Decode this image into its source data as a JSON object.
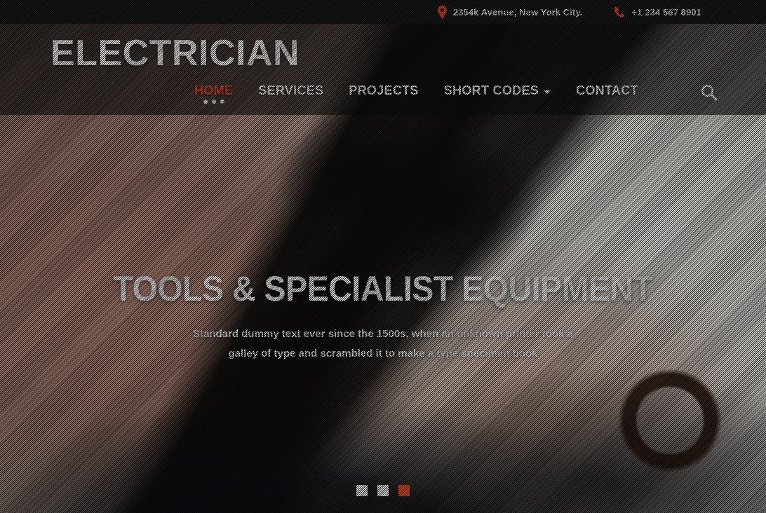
{
  "topbar": {
    "location_icon": "map-pin-icon",
    "address": "2354k Avenue, New York City.",
    "phone_icon": "phone-icon",
    "phone": "+1 234 567 8901"
  },
  "header": {
    "brand": "ELECTRICIAN",
    "search_icon": "search-icon",
    "nav": [
      {
        "label": "HOME",
        "active": true,
        "has_dropdown": false
      },
      {
        "label": "SERVICES",
        "active": false,
        "has_dropdown": false
      },
      {
        "label": "PROJECTS",
        "active": false,
        "has_dropdown": false
      },
      {
        "label": "SHORT CODES",
        "active": false,
        "has_dropdown": true
      },
      {
        "label": "CONTACT",
        "active": false,
        "has_dropdown": false
      }
    ]
  },
  "hero": {
    "title": "TOOLS & SPECIALIST EQUIPMENT",
    "subtitle": "Standard dummy text ever since the 1500s, when an unknown printer took a galley of type and scrambled it to make a type specimen book",
    "slides": [
      {
        "index": 1,
        "active": false
      },
      {
        "index": 2,
        "active": false
      },
      {
        "index": 3,
        "active": true
      }
    ]
  },
  "colors": {
    "accent": "#f4501e",
    "accent_slide": "#f9500e",
    "topbar_bg": "#1b1b1b",
    "text_light": "#ffffff"
  }
}
